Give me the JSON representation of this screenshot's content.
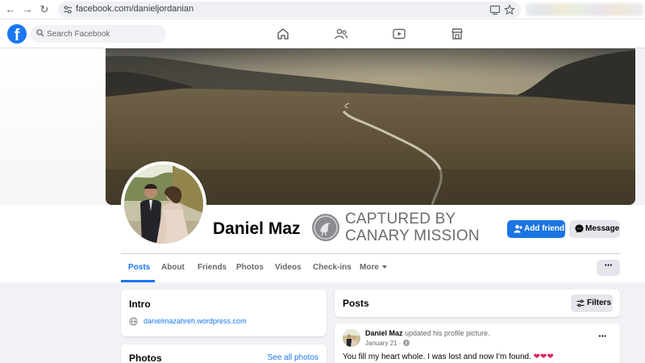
{
  "browser": {
    "url": "facebook.com/danieljordanian"
  },
  "header": {
    "logo": "f",
    "search_placeholder": "Search Facebook"
  },
  "profile": {
    "name": "Daniel Maz",
    "watermark_line1": "CAPTURED BY",
    "watermark_line2": "CANARY MISSION",
    "add_friend_label": "Add friend",
    "message_label": "Message"
  },
  "tabs": [
    {
      "label": "Posts",
      "active": true
    },
    {
      "label": "About"
    },
    {
      "label": "Friends"
    },
    {
      "label": "Photos"
    },
    {
      "label": "Videos"
    },
    {
      "label": "Check-ins"
    },
    {
      "label": "More"
    }
  ],
  "intro": {
    "title": "Intro",
    "website": "danielmazahreh.wordpress.com"
  },
  "photos": {
    "title": "Photos",
    "see_all": "See all photos"
  },
  "posts": {
    "title": "Posts",
    "filters_label": "Filters",
    "items": [
      {
        "author": "Daniel Maz",
        "action": " updated his profile picture.",
        "date": "January 21 ·",
        "text": "You fill my heart whole. I was lost and now I'm found. ",
        "hearts": "❤❤❤"
      }
    ]
  },
  "colors": {
    "brand": "#1877f2",
    "button_primary": "#1b74e4",
    "page_bg": "#f0f2f5"
  }
}
